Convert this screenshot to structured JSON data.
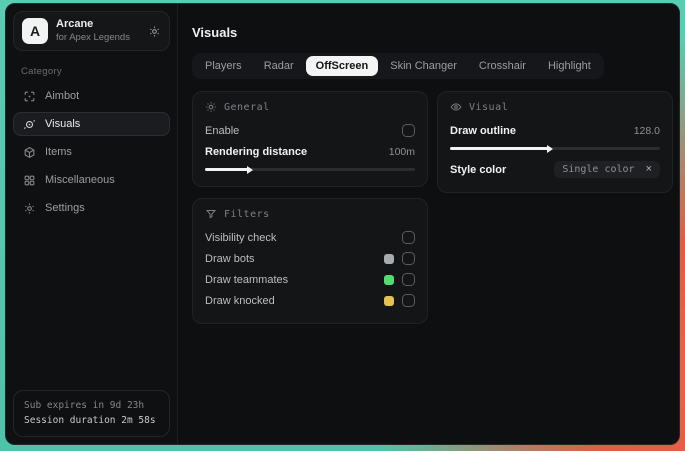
{
  "app": {
    "logo_letter": "A",
    "name": "Arcane",
    "subtitle": "for Apex Legends"
  },
  "sidebar": {
    "category_label": "Category",
    "items": [
      {
        "label": "Aimbot",
        "selected": false
      },
      {
        "label": "Visuals",
        "selected": true
      },
      {
        "label": "Items",
        "selected": false
      },
      {
        "label": "Miscellaneous",
        "selected": false
      },
      {
        "label": "Settings",
        "selected": false
      }
    ],
    "footer": {
      "sub_expires": "Sub expires in 9d 23h",
      "session_duration": "Session duration 2m 58s"
    }
  },
  "main": {
    "title": "Visuals",
    "tabs": [
      {
        "label": "Players",
        "selected": false
      },
      {
        "label": "Radar",
        "selected": false
      },
      {
        "label": "OffScreen",
        "selected": true
      },
      {
        "label": "Skin Changer",
        "selected": false
      },
      {
        "label": "Crosshair",
        "selected": false
      },
      {
        "label": "Highlight",
        "selected": false
      }
    ],
    "panels": {
      "general": {
        "title": "General",
        "enable_label": "Enable",
        "enable_checked": false,
        "rendering_label": "Rendering distance",
        "rendering_value": "100m",
        "slider_percent": 22
      },
      "visual": {
        "title": "Visual",
        "outline_label": "Draw outline",
        "outline_value": "128.0",
        "slider_percent": 48,
        "style_label": "Style color",
        "style_value": "Single color",
        "clear_glyph": "×"
      },
      "filters": {
        "title": "Filters",
        "rows": [
          {
            "label": "Visibility check",
            "checked": false
          },
          {
            "label": "Draw bots",
            "swatch": "#a8abae",
            "checked": false
          },
          {
            "label": "Draw teammates",
            "swatch": "#4fdd72",
            "checked": false
          },
          {
            "label": "Draw knocked",
            "swatch": "#e4c153",
            "checked": false
          }
        ]
      }
    }
  },
  "colors": {
    "desktop_teal": "#53c8ad",
    "desktop_coral": "#e05c45",
    "selected_tab_bg": "#f4f4f4",
    "window_bg": "#0e0f11"
  }
}
